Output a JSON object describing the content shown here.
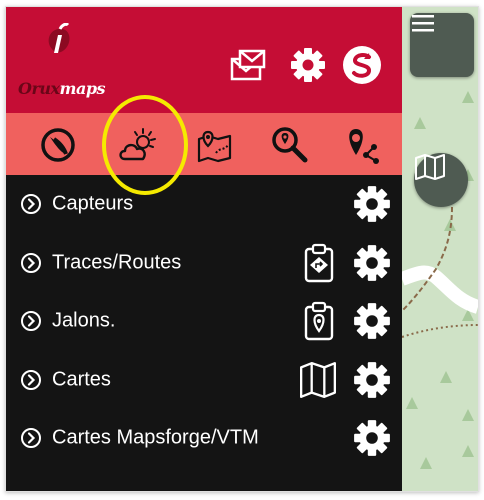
{
  "app": {
    "logo_part1": "Orux",
    "logo_part2": "maps"
  },
  "header": {
    "icons": [
      "mail-icon",
      "gear-icon",
      "sync-icon"
    ]
  },
  "toolbar": {
    "icons": [
      "compass-icon",
      "weather-icon",
      "map-pin-route-icon",
      "search-location-icon",
      "share-location-icon"
    ],
    "highlight_color": "#f5ea00"
  },
  "menu": {
    "items": [
      {
        "label": "Capteurs"
      },
      {
        "label": "Traces/Routes"
      },
      {
        "label": "Jalons."
      },
      {
        "label": "Cartes"
      },
      {
        "label": "Cartes Mapsforge/VTM"
      }
    ]
  },
  "colors": {
    "header_bg": "#c50d35",
    "toolbar_bg": "#f0615e",
    "drawer_bg": "#141414",
    "map_bg": "#cfe2c6"
  }
}
